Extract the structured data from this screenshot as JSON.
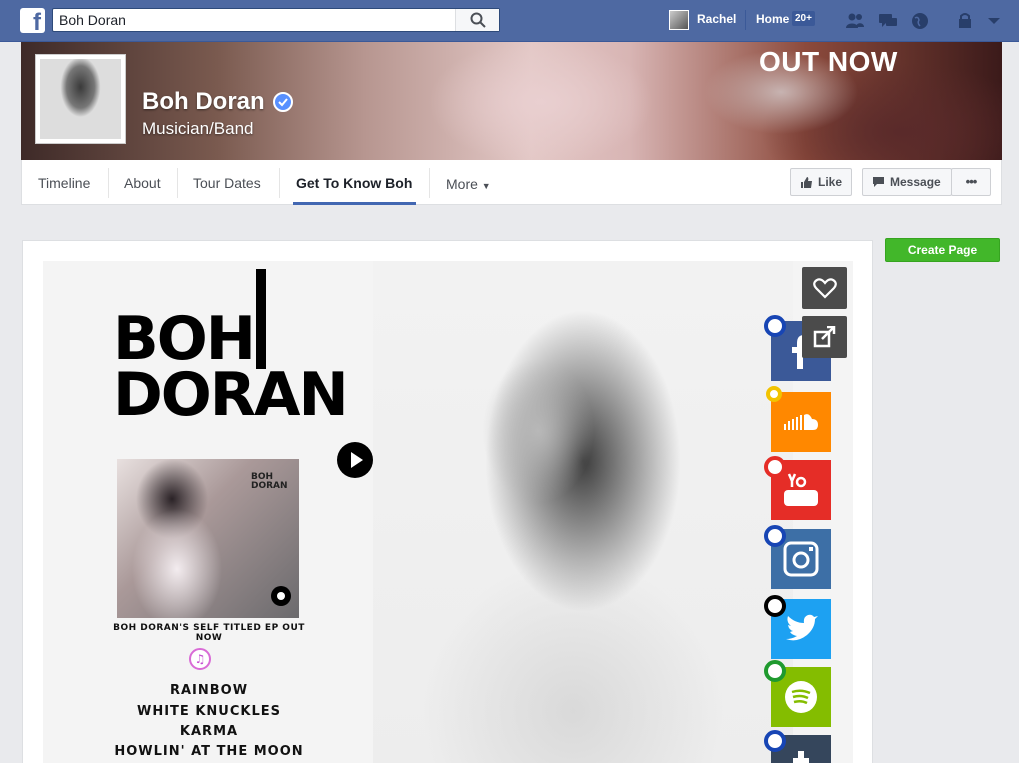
{
  "search": {
    "value": "Boh Doran"
  },
  "topnav": {
    "user": "Rachel",
    "home": "Home",
    "home_count": "20+"
  },
  "cover": {
    "overlay_text": "OUT NOW"
  },
  "page": {
    "name": "Boh Doran",
    "category": "Musician/Band"
  },
  "tabs": [
    {
      "label": "Timeline"
    },
    {
      "label": "About"
    },
    {
      "label": "Tour Dates"
    },
    {
      "label": "Get To Know Boh"
    },
    {
      "label": "More"
    }
  ],
  "actions": {
    "like": "Like",
    "message": "Message",
    "more": "•••"
  },
  "sidebar": {
    "create_page": "Create Page"
  },
  "app": {
    "logo_line1": "BOH",
    "logo_line2": "DORAN",
    "album_logo_line1": "BOH",
    "album_logo_line2": "DORAN",
    "ep_caption": "BOH DORAN'S SELF TITLED EP OUT NOW",
    "itunes_glyph": "♫",
    "tracks": [
      "RAINBOW",
      "WHITE KNUCKLES",
      "KARMA",
      "HOWLIN' AT THE MOON"
    ],
    "social": [
      {
        "name": "facebook",
        "color": "#3b5998",
        "ring": "#1745b4"
      },
      {
        "name": "soundcloud",
        "color": "#ff8800",
        "ring": "#f2c300"
      },
      {
        "name": "youtube",
        "color": "#e52d27",
        "ring": "#e52d27"
      },
      {
        "name": "instagram",
        "color": "#3d6fa6",
        "ring": "#1745b4"
      },
      {
        "name": "twitter",
        "color": "#1da1f2",
        "ring": "#000000"
      },
      {
        "name": "spotify",
        "color": "#84bd00",
        "ring": "#1f9a2e"
      },
      {
        "name": "tumblr",
        "color": "#35465c",
        "ring": "#1745b4"
      }
    ]
  }
}
